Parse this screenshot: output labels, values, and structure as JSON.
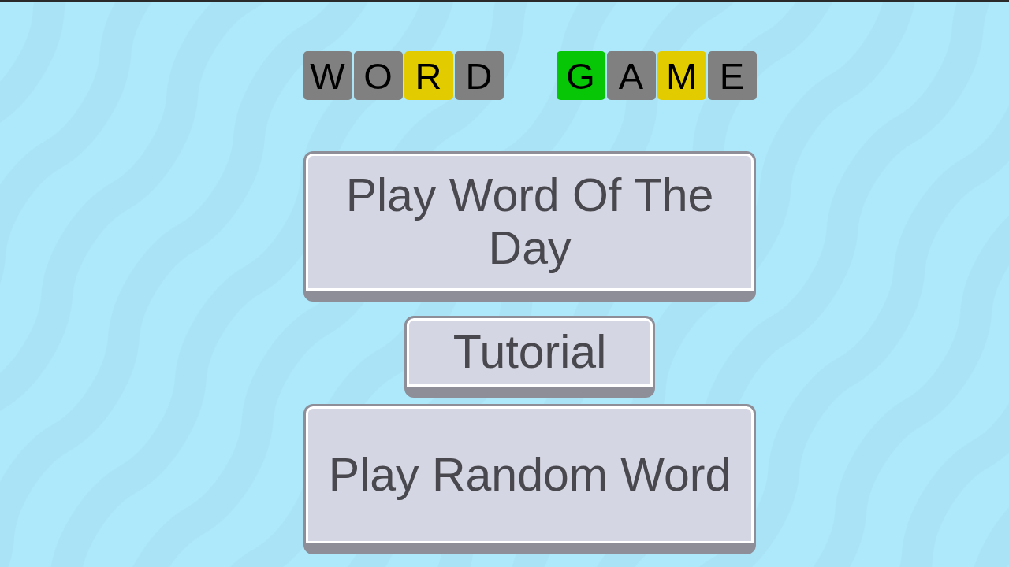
{
  "title": {
    "words": [
      {
        "tiles": [
          {
            "letter": "W",
            "color": "#808080"
          },
          {
            "letter": "O",
            "color": "#808080"
          },
          {
            "letter": "R",
            "color": "#e2cc00"
          },
          {
            "letter": "D",
            "color": "#808080"
          }
        ]
      },
      {
        "tiles": [
          {
            "letter": "G",
            "color": "#06c606"
          },
          {
            "letter": "A",
            "color": "#808080"
          },
          {
            "letter": "M",
            "color": "#e2cc00"
          },
          {
            "letter": "E",
            "color": "#808080"
          }
        ]
      }
    ]
  },
  "buttons": [
    {
      "label": "Play Word Of The Day",
      "kind": "large"
    },
    {
      "label": "Tutorial",
      "kind": "small"
    },
    {
      "label": "Play Random Word",
      "kind": "large"
    }
  ]
}
